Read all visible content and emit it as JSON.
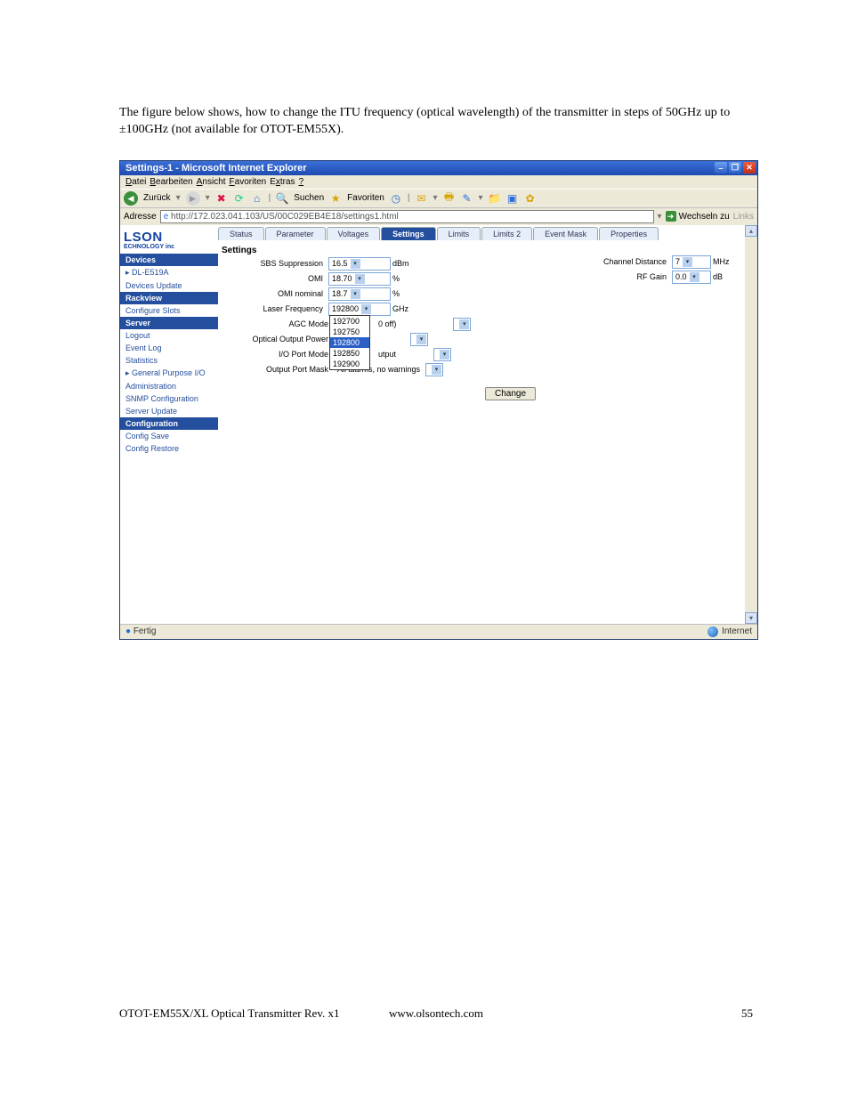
{
  "intro_text": "The figure below shows, how to change the ITU frequency (optical wavelength) of the transmitter in steps of 50GHz up to ±100GHz (not available for OTOT-EM55X).",
  "window": {
    "title": "Settings-1 - Microsoft Internet Explorer",
    "menu": {
      "file": "Datei",
      "edit": "Bearbeiten",
      "view": "Ansicht",
      "favorites": "Favoriten",
      "tools": "Extras",
      "help": "?"
    },
    "toolbar": {
      "back": "Zurück",
      "search": "Suchen",
      "favorites": "Favoriten"
    },
    "address": {
      "label": "Adresse",
      "url": "http://172.023.041.103/US/00C029EB4E18/settings1.html",
      "go": "Wechseln zu",
      "links": "Links"
    }
  },
  "brand": {
    "line1": "LSON",
    "line2": "ECHNOLOGY inc"
  },
  "sidebar": {
    "sections": {
      "devices": "Devices",
      "rackview": "Rackview",
      "server": "Server",
      "configuration": "Configuration"
    },
    "links": {
      "device_active": "DL-E519A",
      "devices_update": "Devices Update",
      "configure_slots": "Configure Slots",
      "logout": "Logout",
      "event_log": "Event Log",
      "statistics": "Statistics",
      "gpio": "General Purpose I/O",
      "administration": "Administration",
      "snmp": "SNMP Configuration",
      "server_update": "Server Update",
      "config_save": "Config Save",
      "config_restore": "Config Restore"
    }
  },
  "tabs": {
    "status": "Status",
    "parameter": "Parameter",
    "voltages": "Voltages",
    "settings": "Settings",
    "limits": "Limits",
    "limits2": "Limits 2",
    "event_mask": "Event Mask",
    "properties": "Properties"
  },
  "panel_title": "Settings",
  "form": {
    "sbs_supp_label": "SBS Suppression",
    "sbs_supp_value": "16.5",
    "sbs_supp_unit": "dBm",
    "omi_label": "OMI",
    "omi_value": "18.70",
    "omi_unit": "%",
    "omi_nominal_label": "OMI nominal",
    "omi_nominal_value": "18.7",
    "omi_nominal_unit": "%",
    "laser_freq_label": "Laser Frequency",
    "laser_freq_value": "192800",
    "laser_freq_unit": "GHz",
    "agc_mode_label": "AGC Mode",
    "agc_mode_trailing": "0 off)",
    "optical_out_label": "Optical Output Power",
    "io_port_mode_label": "I/O Port Mode",
    "io_port_mode_trailing": "utput",
    "output_port_mask_label": "Output Port Mask",
    "output_port_mask_value": "All alarms, no warnings",
    "channel_distance_label": "Channel Distance",
    "channel_distance_value": "7",
    "channel_distance_unit": "MHz",
    "rf_gain_label": "RF Gain",
    "rf_gain_value": "0.0",
    "rf_gain_unit": "dB",
    "dropdown_options": [
      "192700",
      "192750",
      "192800",
      "192850",
      "192900"
    ],
    "change_button": "Change"
  },
  "status_bar": {
    "left": "Fertig",
    "right": "Internet"
  },
  "footer": {
    "left": "OTOT-EM55X/XL Optical Transmitter Rev. x1",
    "center": "www.olsontech.com",
    "right": "55"
  }
}
